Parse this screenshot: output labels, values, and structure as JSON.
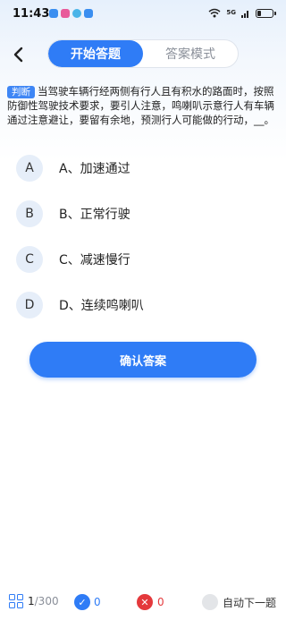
{
  "status_bar": {
    "time": "11:43",
    "network": "5G",
    "app_colors": [
      "#3a8ef0",
      "#e85a9a",
      "#49b4e8",
      "#3a8ef0"
    ]
  },
  "header": {
    "tabs": [
      {
        "label": "开始答题",
        "active": true
      },
      {
        "label": "答案模式",
        "active": false
      }
    ]
  },
  "question": {
    "type": "判断",
    "text": "当驾驶车辆行经两侧有行人且有积水的路面时，按照防御性驾驶技术要求，要引人注意，鸣喇叭示意行人有车辆通过注意避让，要留有余地，预测行人可能做的行动，__。"
  },
  "options": [
    {
      "letter": "A",
      "text": "A、加速通过"
    },
    {
      "letter": "B",
      "text": "B、正常行驶"
    },
    {
      "letter": "C",
      "text": "C、减速慢行"
    },
    {
      "letter": "D",
      "text": "D、连续鸣喇叭"
    }
  ],
  "confirm_label": "确认答案",
  "footer": {
    "progress_current": "1",
    "progress_total": "/300",
    "correct_count": "0",
    "wrong_count": "0",
    "auto_next_label": "自动下一题"
  },
  "colors": {
    "accent": "#2f7cf6",
    "correct": "#2f7cf6",
    "wrong": "#e4393c"
  }
}
